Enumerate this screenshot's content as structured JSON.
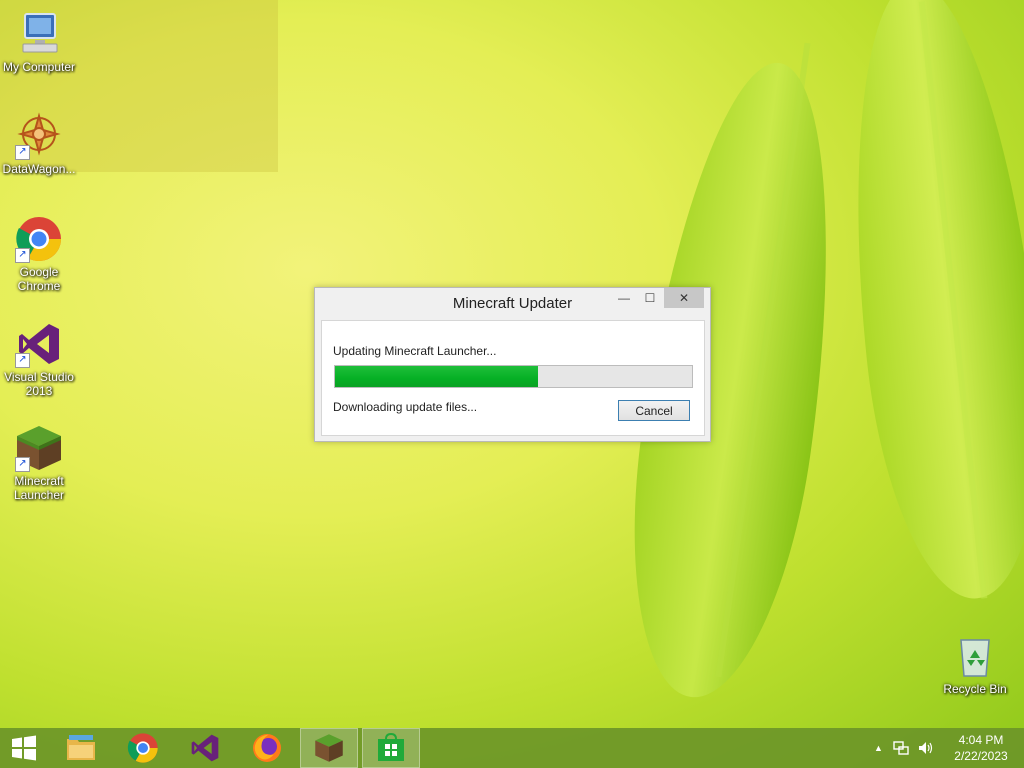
{
  "desktop": {
    "icons": [
      {
        "label": "My Computer",
        "icon": "computer-icon"
      },
      {
        "label": "DataWagon...",
        "icon": "datawagon-icon"
      },
      {
        "label": "Google Chrome",
        "icon": "chrome-icon"
      },
      {
        "label": "Visual Studio 2013",
        "icon": "visual-studio-icon"
      },
      {
        "label": "Minecraft Launcher",
        "icon": "minecraft-icon"
      },
      {
        "label": "Recycle Bin",
        "icon": "recycle-bin-icon"
      }
    ]
  },
  "dialog": {
    "title": "Minecraft Updater",
    "minimize": "—",
    "maximize": "☐",
    "close": "✕",
    "status_main": "Updating Minecraft Launcher...",
    "status_detail": "Downloading update files...",
    "progress_fraction": 0.57,
    "cancel_label": "Cancel"
  },
  "taskbar": {
    "items": [
      {
        "icon": "start-icon"
      },
      {
        "icon": "file-explorer-icon"
      },
      {
        "icon": "chrome-icon"
      },
      {
        "icon": "visual-studio-icon"
      },
      {
        "icon": "firefox-icon"
      },
      {
        "icon": "minecraft-icon"
      },
      {
        "icon": "store-icon"
      }
    ],
    "tray": {
      "chevron": "▲",
      "time": "4:04 PM",
      "date": "2/22/2023"
    }
  },
  "colors": {
    "progress_green": "#06b025",
    "taskbar": "#6c9628",
    "button_border": "#3c7fb1"
  }
}
